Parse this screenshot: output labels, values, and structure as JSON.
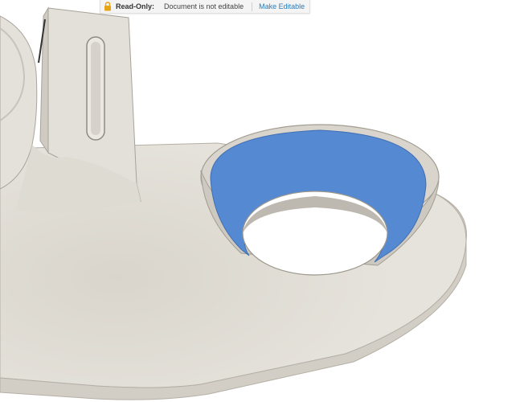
{
  "banner": {
    "lock_icon": "lock-icon",
    "label": "Read-Only:",
    "message": "Document is not editable",
    "action_label": "Make Editable",
    "accent_color": "#e8a417",
    "link_color": "#2b7bbd"
  },
  "scene": {
    "model_color": "#e6e3dc",
    "selected_face_color": "#5589d2"
  }
}
